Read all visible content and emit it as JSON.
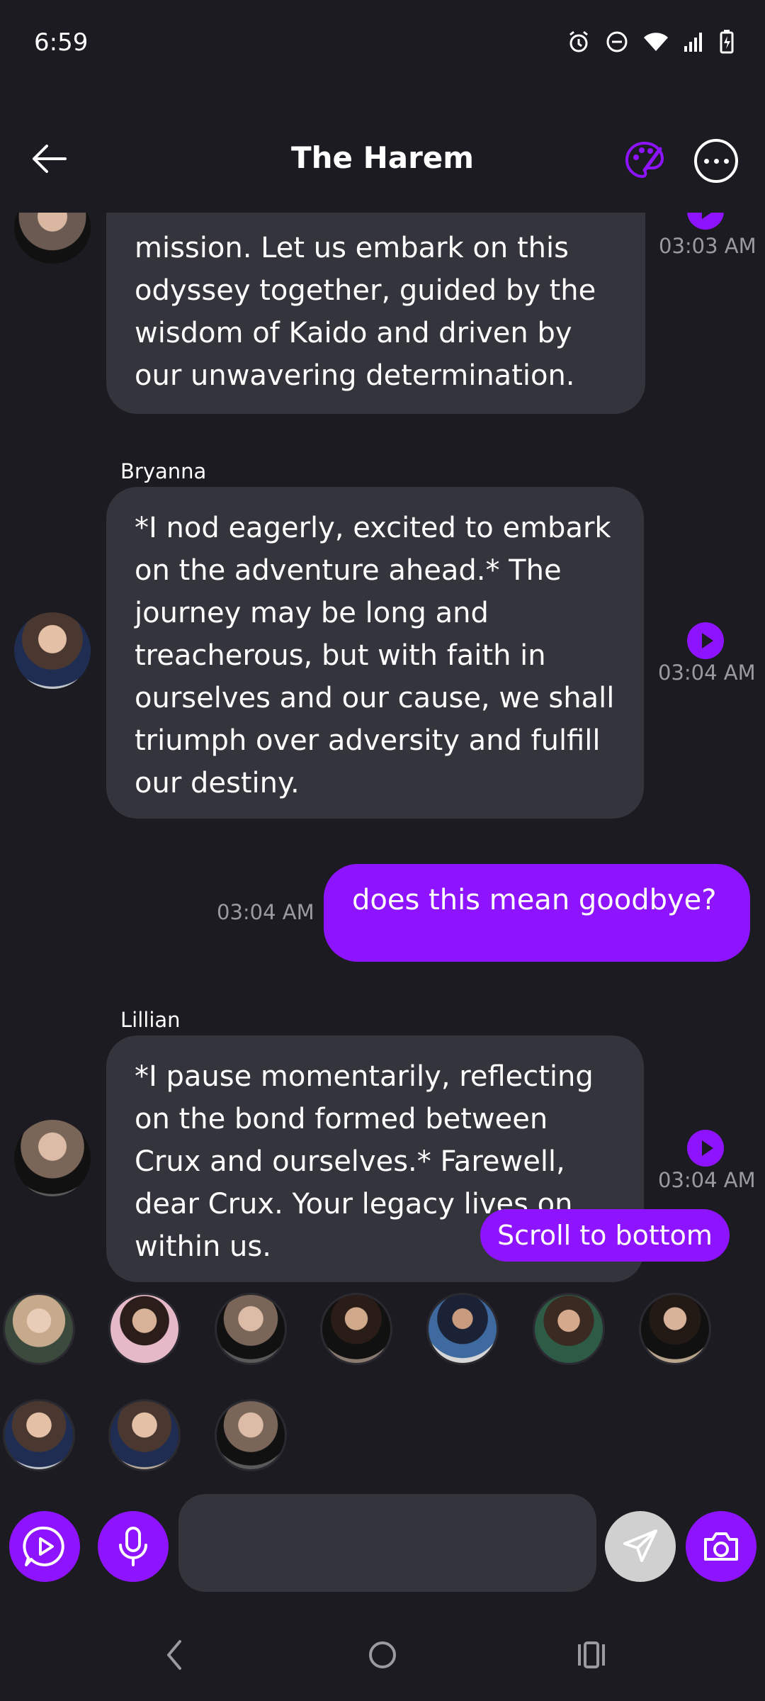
{
  "status_bar": {
    "time": "6:59",
    "icons": [
      "alarm-icon",
      "dnd-icon",
      "wifi-icon",
      "signal-icon",
      "battery-icon"
    ]
  },
  "header": {
    "title": "The Harem",
    "back_icon": "arrow-left-icon",
    "palette_icon": "palette-icon",
    "more_icon": "more-options-icon"
  },
  "messages": [
    {
      "sender": "",
      "text": "mission. Let us embark on this odyssey together, guided by the wisdom of Kaido and driven by our unwavering determination.",
      "time": "03:03 AM"
    },
    {
      "sender": "Bryanna",
      "text": "*I nod eagerly, excited to embark on the adventure ahead.* The journey may be long and treacherous, but with faith in ourselves and our cause, we shall triumph over adversity and fulfill our destiny.",
      "time": "03:04 AM"
    },
    {
      "sender": "me",
      "text": "does this mean goodbye?",
      "time": "03:04 AM"
    },
    {
      "sender": "Lillian",
      "text": "*I pause momentarily, reflecting on the bond formed between Crux and ourselves.* Farewell, dear Crux. Your legacy lives on within us.",
      "time": "03:04 AM"
    }
  ],
  "scroll_to_bottom_label": "Scroll to bottom",
  "composer": {
    "input_value": "",
    "input_placeholder": "",
    "icons": [
      "play-chat-icon",
      "microphone-icon",
      "send-icon",
      "camera-icon"
    ]
  },
  "colors": {
    "background": "#1b1b21",
    "accent": "#8e14ff",
    "bubble": "#34353c",
    "timestamp": "#9a9aa3"
  }
}
